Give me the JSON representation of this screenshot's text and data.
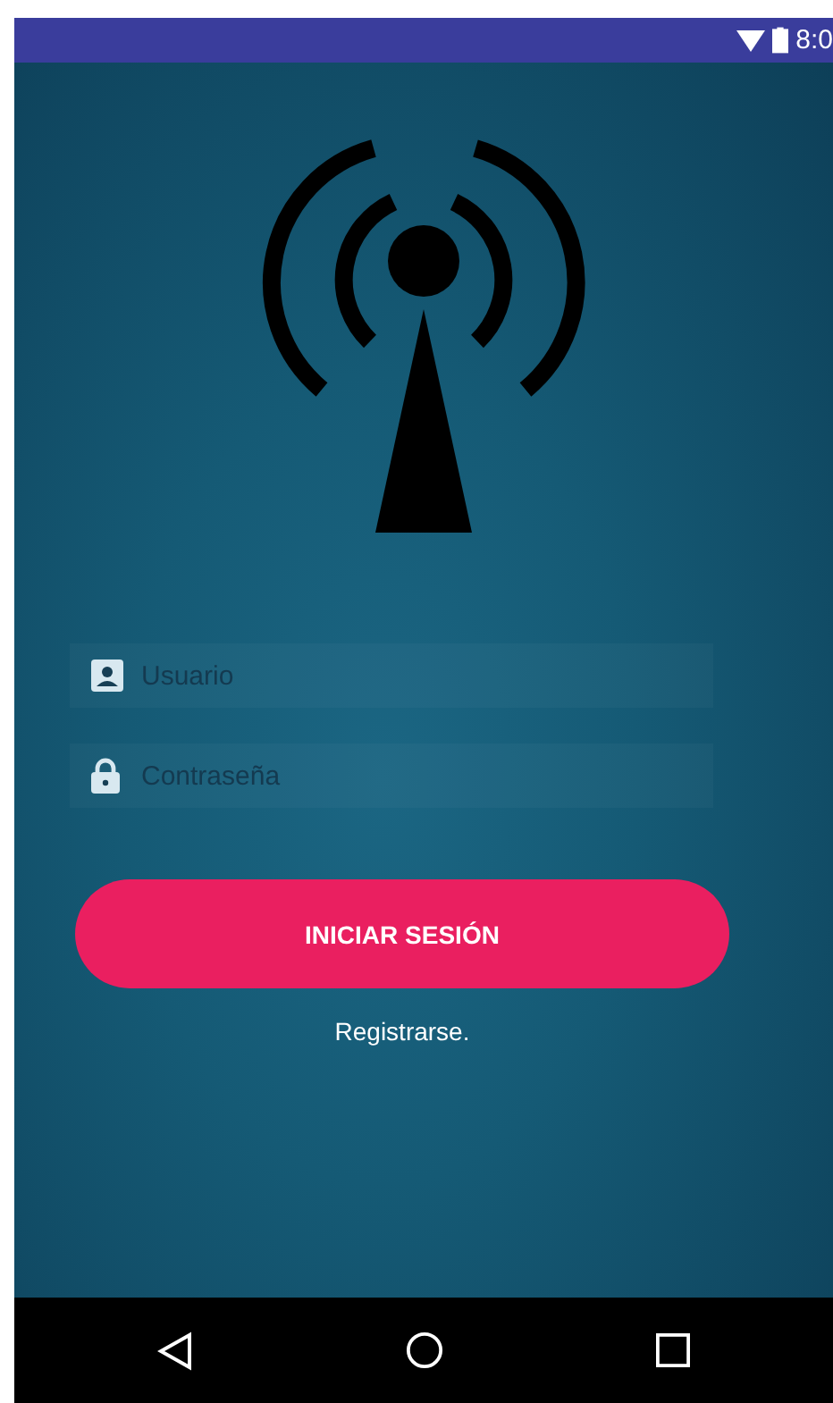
{
  "status_bar": {
    "time": "8:0"
  },
  "fields": [
    {
      "kind": "user",
      "placeholder": "Usuario"
    },
    {
      "kind": "password",
      "placeholder": "Contraseña"
    }
  ],
  "login_button": {
    "label": "INICIAR SESIÓN"
  },
  "register_link": {
    "label": "Registrarse."
  }
}
